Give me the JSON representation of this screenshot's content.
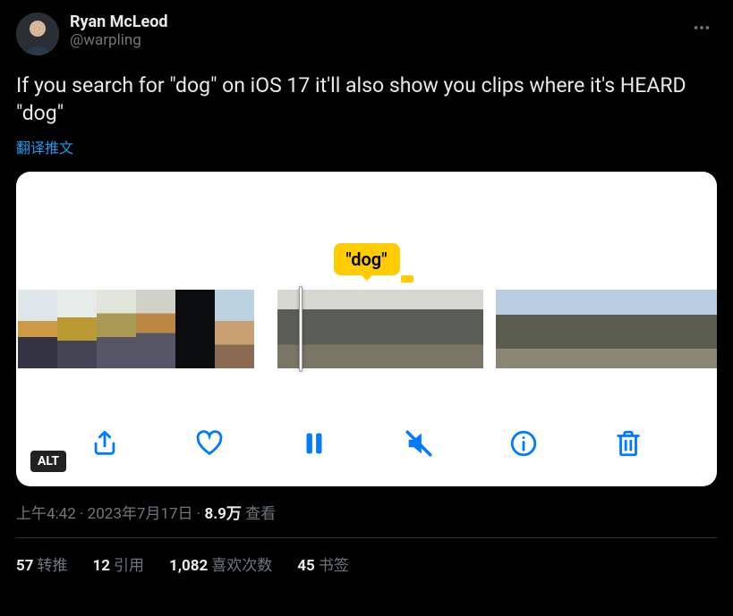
{
  "author": {
    "display_name": "Ryan McLeod",
    "handle": "@warpling"
  },
  "tweet_text": "If you search for \"dog\" on iOS 17 it'll also show you clips where it's HEARD \"dog\"",
  "translate_label": "翻译推文",
  "media": {
    "tooltip": "\"dog\"",
    "alt_badge": "ALT",
    "toolbar": {
      "share": "share",
      "like": "like",
      "pause": "pause",
      "mute": "mute",
      "info": "info",
      "delete": "delete"
    }
  },
  "meta": {
    "time": "上午4:42",
    "date": "2023年7月17日",
    "views_number": "8.9万",
    "views_label": "查看"
  },
  "stats": {
    "retweets_num": "57",
    "retweets_label": "转推",
    "quotes_num": "12",
    "quotes_label": "引用",
    "likes_num": "1,082",
    "likes_label": "喜欢次数",
    "bookmarks_num": "45",
    "bookmarks_label": "书签"
  }
}
